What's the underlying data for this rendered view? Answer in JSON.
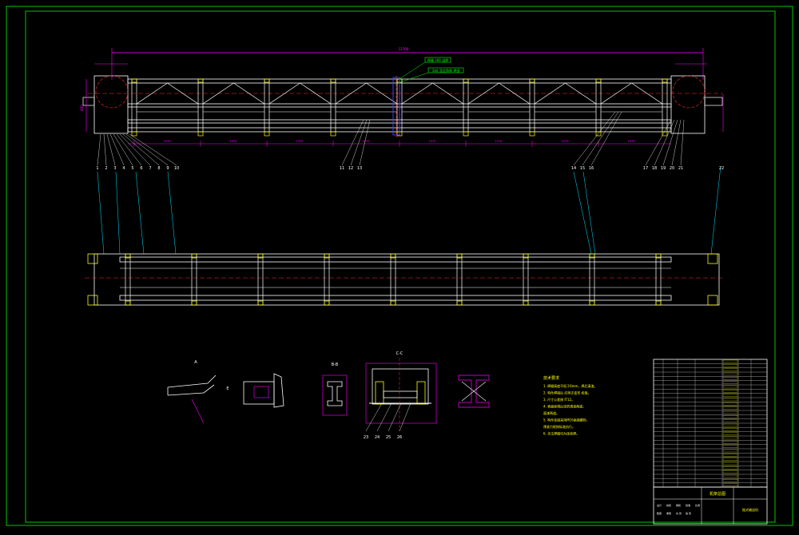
{
  "colors": {
    "background": "#000000",
    "frame": "#00c800",
    "structure": "#ffffff",
    "dimension": "#ff00ff",
    "centerline": "#ff3030",
    "leader": "#00e5ff",
    "note": "#ffff00",
    "highlight": "#ffff00",
    "bolt": "#4040ff"
  },
  "top_view": {
    "overall_dim": "12700",
    "segment_dims": [
      "1570",
      "1570",
      "1570",
      "1570",
      "1570",
      "1570",
      "1570",
      "1570",
      "1570",
      "1570"
    ],
    "height_dim": "850",
    "callouts_left": [
      "1",
      "2",
      "3",
      "4",
      "5",
      "6",
      "7",
      "8",
      "9",
      "10"
    ],
    "callouts_mid": [
      "11",
      "12",
      "13"
    ],
    "callouts_right_a": [
      "14",
      "15",
      "16"
    ],
    "callouts_right_b": [
      "17",
      "18",
      "19",
      "20",
      "21"
    ],
    "callout_far": "22",
    "note_tags": [
      "焊缝 300 组焊",
      "导轨 固定角钢 焊接"
    ]
  },
  "details": {
    "section_labels": [
      "A",
      "E",
      "B-B",
      "C-C"
    ],
    "bottom_callouts": [
      "23",
      "24",
      "25",
      "26"
    ]
  },
  "notes": {
    "heading": "技术要求",
    "lines": [
      "1. 焊缝高度不低于6mm，焊后清渣。",
      "2. 构件焊接后 应矫正变形 校直。",
      "3. 尺寸公差按 IT12。",
      "4. 表面除锈后涂防锈漆两道，",
      "   面漆两道。",
      "5. 构件连接采用M16高强螺栓，",
      "   预紧力矩按标准执行。",
      "6. 未注焊缝均为连续焊。"
    ]
  },
  "title_block": {
    "drawing_title": "机架总图",
    "project": "链式输送机",
    "rows": 30,
    "footer_labels": [
      "设计",
      "校核",
      "审核",
      "批准",
      "比例",
      "数量",
      "重量",
      "共 张",
      "第 张"
    ]
  }
}
